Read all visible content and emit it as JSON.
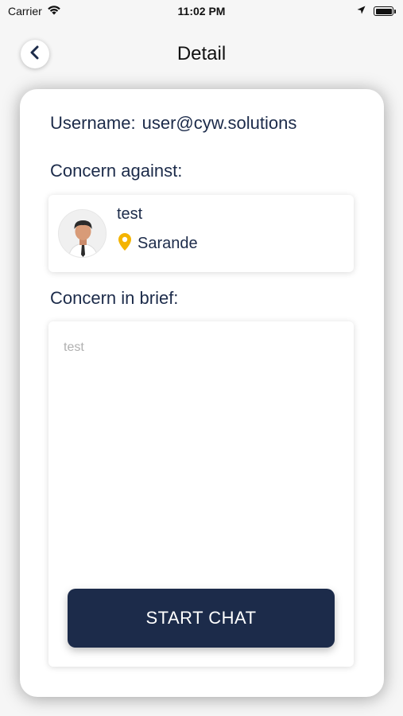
{
  "status_bar": {
    "carrier": "Carrier",
    "time": "11:02 PM"
  },
  "header": {
    "title": "Detail"
  },
  "detail": {
    "username_label": "Username:",
    "username_value": "user@cyw.solutions",
    "concern_against_label": "Concern against:",
    "person": {
      "name": "test",
      "location": "Sarande"
    },
    "concern_brief_label": "Concern in  brief:",
    "concern_brief_text": "test",
    "start_chat_label": "START CHAT"
  },
  "colors": {
    "primary": "#1c2b4a",
    "location_pin": "#f4b400",
    "placeholder_text": "#b0b0b0"
  },
  "icons": {
    "wifi": "wifi-icon",
    "location_arrow": "location-arrow-icon",
    "battery": "battery-icon",
    "back": "chevron-left-icon",
    "pin": "map-pin-icon"
  }
}
